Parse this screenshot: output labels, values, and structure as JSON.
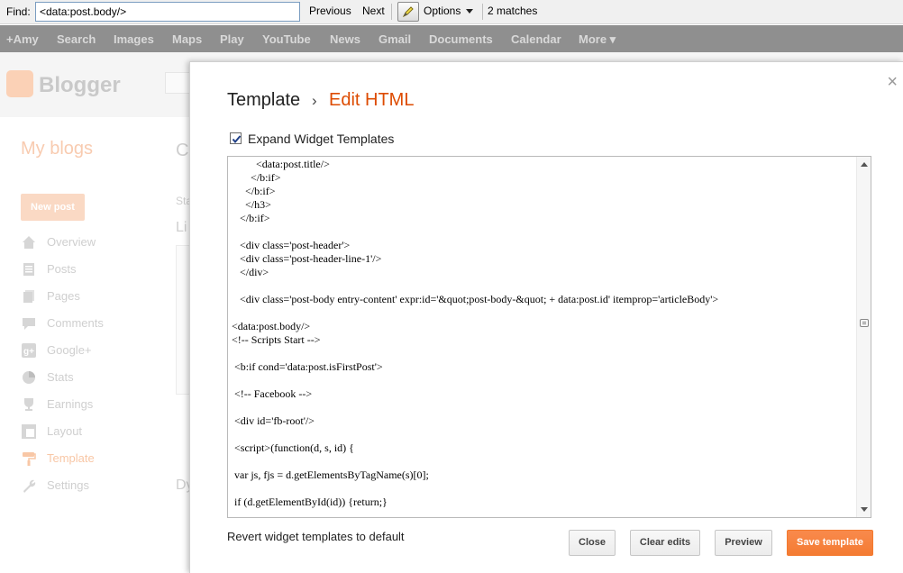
{
  "findbar": {
    "label": "Find:",
    "query": "<data:post.body/>",
    "previous": "Previous",
    "next": "Next",
    "options": "Options",
    "matches": "2 matches"
  },
  "google_bar": {
    "items": [
      "+Amy",
      "Search",
      "Images",
      "Maps",
      "Play",
      "YouTube",
      "News",
      "Gmail",
      "Documents",
      "Calendar",
      "More ▾"
    ]
  },
  "background": {
    "logo_text": "Blogger",
    "my_blogs": "My blogs",
    "partial_c": "C",
    "partial_sta": "Sta",
    "partial_li": "Li",
    "partial_dy": "Dy",
    "new_post": "New post",
    "nav": [
      "Overview",
      "Posts",
      "Pages",
      "Comments",
      "Google+",
      "Stats",
      "Earnings",
      "Layout",
      "Template",
      "Settings"
    ],
    "active_nav": "Template",
    "colors": {
      "accent": "#f8c7a6"
    }
  },
  "dialog": {
    "breadcrumb_parent": "Template",
    "breadcrumb_separator": "›",
    "breadcrumb_current": "Edit HTML",
    "expand_widget_label": "Expand Widget Templates",
    "expand_widget_checked": true,
    "code_lines": [
      "         <data:post.title/>",
      "       </b:if>",
      "     </b:if>",
      "     </h3>",
      "   </b:if>",
      "",
      "   <div class='post-header'>",
      "   <div class='post-header-line-1'/>",
      "   </div>",
      "",
      "   <div class='post-body entry-content' expr:id='&quot;post-body-&quot; + data:post.id' itemprop='articleBody'>",
      "",
      "<data:post.body/>",
      "<!-- Scripts Start -->",
      "",
      " <b:if cond='data:post.isFirstPost'>",
      "",
      " <!-- Facebook -->",
      "",
      " <div id='fb-root'/>",
      "",
      " <script>(function(d, s, id) {",
      "",
      " var js, fjs = d.getElementsByTagName(s)[0];",
      "",
      " if (d.getElementById(id)) {return;}"
    ],
    "revert_link": "Revert widget templates to default",
    "buttons": {
      "close": "Close",
      "clear_edits": "Clear edits",
      "preview": "Preview",
      "save_template": "Save template"
    },
    "colors": {
      "title_accent": "#dd4b00",
      "save_button": "#f47b32"
    }
  }
}
